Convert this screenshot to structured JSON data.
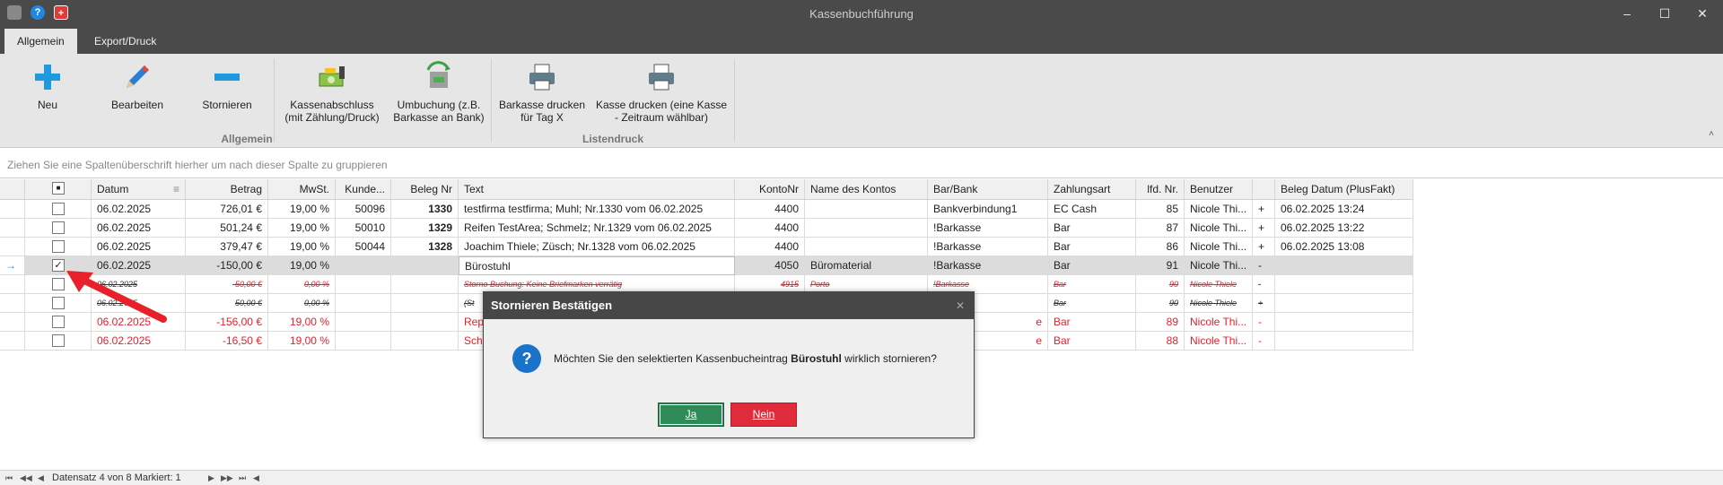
{
  "window": {
    "title": "Kassenbuchführung",
    "minimize": "–",
    "maximize": "☐",
    "close": "✕"
  },
  "quick_access": {
    "help": "?",
    "swiss": "+"
  },
  "tabs": [
    {
      "label": "Allgemein",
      "active": true
    },
    {
      "label": "Export/Druck",
      "active": false
    }
  ],
  "ribbon": {
    "buttons": {
      "neu": "Neu",
      "bearbeiten": "Bearbeiten",
      "stornieren": "Stornieren",
      "kassenabschluss_1": "Kassenabschluss",
      "kassenabschluss_2": "(mit Zählung/Druck)",
      "umbuchung_1": "Umbuchung (z.B.",
      "umbuchung_2": "Barkasse an Bank)",
      "barkasse_1": "Barkasse drucken",
      "barkasse_2": "für Tag X",
      "kasse_1": "Kasse drucken (eine Kasse",
      "kasse_2": "- Zeitraum wählbar)"
    },
    "groups": {
      "allgemein": "Allgemein",
      "listendruck": "Listendruck"
    },
    "collapse": "˄"
  },
  "group_panel": "Ziehen Sie eine Spaltenüberschrift hierher um nach dieser Spalte zu gruppieren",
  "grid": {
    "headers": {
      "select_all": "■",
      "datum": "Datum",
      "betrag": "Betrag",
      "mwst": "MwSt.",
      "kunde": "Kunde...",
      "beleg": "Beleg Nr",
      "text": "Text",
      "konto": "KontoNr",
      "kontoname": "Name des Kontos",
      "barbank": "Bar/Bank",
      "zahlungsart": "Zahlungsart",
      "lfd": "lfd. Nr.",
      "benutzer": "Benutzer",
      "plusfakt": "Beleg Datum (PlusFakt)"
    },
    "rows": [
      {
        "indicator": "",
        "checked": "",
        "datum": "06.02.2025",
        "betrag": "726,01 €",
        "mwst": "19,00 %",
        "kunde": "50096",
        "beleg": "1330",
        "text": "testfirma testfirma; Muhl; Nr.1330 vom 06.02.2025",
        "konto": "4400",
        "kontoname": "",
        "barbank": "Bankverbindung1",
        "zahlungsart": "EC Cash",
        "lfd": "85",
        "benutzer": "Nicole Thi...",
        "plus": "+",
        "plusfakt": "06.02.2025 13:24"
      },
      {
        "indicator": "",
        "checked": "",
        "datum": "06.02.2025",
        "betrag": "501,24 €",
        "mwst": "19,00 %",
        "kunde": "50010",
        "beleg": "1329",
        "text": "Reifen TestArea; Schmelz; Nr.1329 vom 06.02.2025",
        "konto": "4400",
        "kontoname": "",
        "barbank": "!Barkasse",
        "zahlungsart": "Bar",
        "lfd": "87",
        "benutzer": "Nicole Thi...",
        "plus": "+",
        "plusfakt": "06.02.2025 13:22"
      },
      {
        "indicator": "",
        "checked": "",
        "datum": "06.02.2025",
        "betrag": "379,47 €",
        "mwst": "19,00 %",
        "kunde": "50044",
        "beleg": "1328",
        "text": "Joachim Thiele; Züsch; Nr.1328 vom 06.02.2025",
        "konto": "4400",
        "kontoname": "",
        "barbank": "!Barkasse",
        "zahlungsart": "Bar",
        "lfd": "86",
        "benutzer": "Nicole Thi...",
        "plus": "+",
        "plusfakt": "06.02.2025 13:08"
      },
      {
        "indicator": "→",
        "checked": "✓",
        "datum": "06.02.2025",
        "betrag": "-150,00 €",
        "mwst": "19,00 %",
        "kunde": "",
        "beleg": "",
        "text": "Bürostuhl",
        "konto": "4050",
        "kontoname": "Büromaterial",
        "barbank": "!Barkasse",
        "zahlungsart": "Bar",
        "lfd": "91",
        "benutzer": "Nicole Thi...",
        "plus": "-",
        "plusfakt": ""
      },
      {
        "indicator": "",
        "checked": "",
        "datum": "06.02.2025",
        "betrag": "-50,00 €",
        "mwst": "0,00 %",
        "kunde": "",
        "beleg": "",
        "text": "Storno Buchung: Keine Briefmarken verrätig",
        "konto": "4915",
        "kontoname": "Porto",
        "barbank": "!Barkasse",
        "zahlungsart": "Bar",
        "lfd": "90",
        "benutzer": "Nicole Thiele",
        "plus": "-",
        "plusfakt": ""
      },
      {
        "indicator": "",
        "checked": "",
        "datum": "06.02.2025",
        "betrag": "50,00 €",
        "mwst": "0,00 %",
        "kunde": "",
        "beleg": "",
        "text": "(St",
        "konto": "",
        "kontoname": "",
        "barbank": "",
        "zahlungsart": "Bar",
        "lfd": "90",
        "benutzer": "Nicole Thiele",
        "plus": "+",
        "plusfakt": ""
      },
      {
        "indicator": "",
        "checked": "",
        "datum": "06.02.2025",
        "betrag": "-156,00 €",
        "mwst": "19,00 %",
        "kunde": "",
        "beleg": "",
        "text": "Rep",
        "konto": "",
        "kontoname": "",
        "barbank": "e",
        "zahlungsart": "Bar",
        "lfd": "89",
        "benutzer": "Nicole Thi...",
        "plus": "-",
        "plusfakt": ""
      },
      {
        "indicator": "",
        "checked": "",
        "datum": "06.02.2025",
        "betrag": "-16,50 €",
        "mwst": "19,00 %",
        "kunde": "",
        "beleg": "",
        "text": "Sch",
        "konto": "",
        "kontoname": "",
        "barbank": "e",
        "zahlungsart": "Bar",
        "lfd": "88",
        "benutzer": "Nicole Thi...",
        "plus": "-",
        "plusfakt": ""
      }
    ]
  },
  "dialog": {
    "title": "Stornieren Bestätigen",
    "close": "✕",
    "icon": "?",
    "message_before": "Möchten Sie den selektierten Kassenbucheintrag ",
    "message_bold": "Bürostuhl",
    "message_after": " wirklich stornieren?",
    "yes": "Ja",
    "no": "Nein"
  },
  "statusbar": {
    "nav_first": "⏮",
    "nav_prev_page": "◀◀",
    "nav_prev": "◀",
    "record": "Datensatz 4 von 8 Markiert: 1",
    "nav_next": "▶",
    "nav_next_page": "▶▶",
    "nav_last": "⏭",
    "nav_scroll": "◀"
  },
  "colors": {
    "titlebar": "#4a4a4a",
    "ribbon": "#e6e6e6",
    "storno_red": "#e8202a",
    "accent_blue": "#1e88e5",
    "ja_green": "#2e8b57",
    "nein_red": "#e02b3b"
  }
}
